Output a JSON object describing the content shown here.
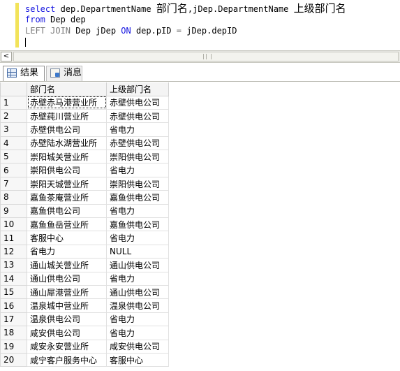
{
  "editor": {
    "lines": [
      [
        {
          "t": "select",
          "c": "kw"
        },
        {
          "t": " dep.DepartmentName ",
          "c": ""
        },
        {
          "t": "部门名",
          "c": "cjk"
        },
        {
          "t": ",jDep.DepartmentName ",
          "c": ""
        },
        {
          "t": "上级部门名",
          "c": "cjk"
        }
      ],
      [
        {
          "t": "from",
          "c": "kw"
        },
        {
          "t": " Dep dep",
          "c": ""
        }
      ],
      [
        {
          "t": "LEFT JOIN",
          "c": "gray"
        },
        {
          "t": " Dep jDep ",
          "c": ""
        },
        {
          "t": "ON",
          "c": "kw"
        },
        {
          "t": " dep.pID ",
          "c": ""
        },
        {
          "t": "=",
          "c": "gray"
        },
        {
          "t": " jDep.depID",
          "c": ""
        }
      ]
    ]
  },
  "scrollbar": {
    "left_arrow": "<"
  },
  "tabs": {
    "results_label": "结果",
    "messages_label": "消息",
    "results_icon": "grid-icon",
    "messages_icon": "message-icon"
  },
  "grid": {
    "columns": [
      "部门名",
      "上级部门名"
    ],
    "rows": [
      [
        "1",
        "赤壁赤马港营业所",
        "赤壁供电公司"
      ],
      [
        "2",
        "赤壁莼川营业所",
        "赤壁供电公司"
      ],
      [
        "3",
        "赤壁供电公司",
        "省电力"
      ],
      [
        "4",
        "赤壁陆水湖营业所",
        "赤壁供电公司"
      ],
      [
        "5",
        "崇阳城关营业所",
        "崇阳供电公司"
      ],
      [
        "6",
        "崇阳供电公司",
        "省电力"
      ],
      [
        "7",
        "崇阳天城营业所",
        "崇阳供电公司"
      ],
      [
        "8",
        "嘉鱼茶庵营业所",
        "嘉鱼供电公司"
      ],
      [
        "9",
        "嘉鱼供电公司",
        "省电力"
      ],
      [
        "10",
        "嘉鱼鱼岳营业所",
        "嘉鱼供电公司"
      ],
      [
        "11",
        "客服中心",
        "省电力"
      ],
      [
        "12",
        "省电力",
        "NULL"
      ],
      [
        "13",
        "通山城关营业所",
        "通山供电公司"
      ],
      [
        "14",
        "通山供电公司",
        "省电力"
      ],
      [
        "15",
        "通山犀港营业所",
        "通山供电公司"
      ],
      [
        "16",
        "温泉城中营业所",
        "温泉供电公司"
      ],
      [
        "17",
        "温泉供电公司",
        "省电力"
      ],
      [
        "18",
        "咸安供电公司",
        "省电力"
      ],
      [
        "19",
        "咸安永安营业所",
        "咸安供电公司"
      ],
      [
        "20",
        "咸宁客户服务中心",
        "客服中心"
      ]
    ]
  }
}
